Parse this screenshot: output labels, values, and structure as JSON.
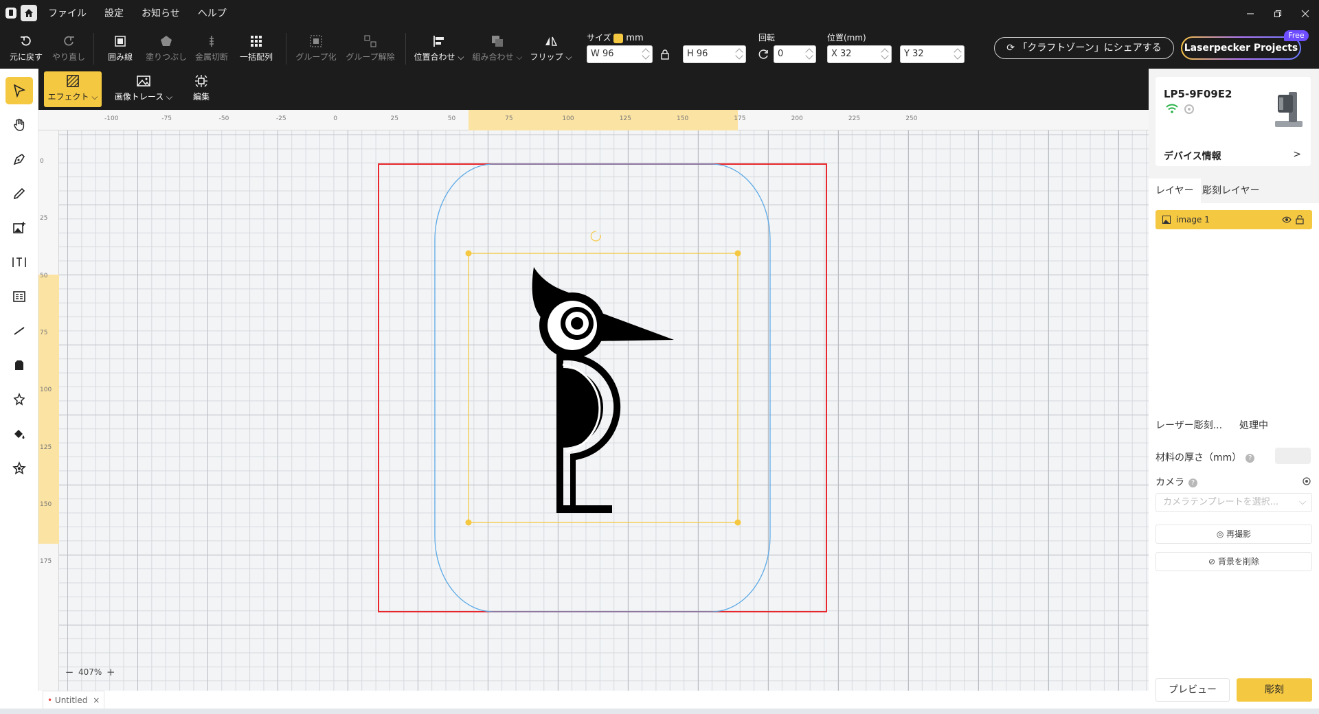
{
  "menu": [
    "ファイル",
    "設定",
    "お知らせ",
    "ヘルプ"
  ],
  "toolbar": {
    "undo": "元に戻す",
    "redo": "やり直し",
    "outline": "囲み線",
    "fill": "塗りつぶし",
    "metal_cut": "金属切断",
    "array": "一括配列",
    "group": "グループ化",
    "ungroup": "グループ解除",
    "align": "位置合わせ",
    "combine": "組み合わせ",
    "flip": "フリップ",
    "size_label": "サイズ",
    "unit": "mm",
    "width": "W 96",
    "height": "H 96",
    "rotate_label": "回転",
    "rotate": "0",
    "position_label": "位置(mm)",
    "x": "X 32",
    "y": "Y 32",
    "share": "「クラフトゾーン」にシェアする",
    "projects": "Laserpecker Projects",
    "free": "Free"
  },
  "subbar": {
    "effect": "エフェクト",
    "trace": "画像トレース",
    "edit": "編集"
  },
  "ruler": {
    "top": [
      "-100",
      "-75",
      "-50",
      "-25",
      "0",
      "25",
      "50",
      "75",
      "100",
      "125",
      "150",
      "175",
      "200",
      "225",
      "250"
    ],
    "left": [
      "0",
      "25",
      "50",
      "75",
      "100",
      "125",
      "150",
      "175"
    ]
  },
  "zoom": "407%",
  "doc_tab": "Untitled",
  "device": {
    "name": "LP5-9F09E2",
    "info": "デバイス情報"
  },
  "layers": {
    "tab_layer": "レイヤー",
    "tab_engrave": "彫刻レイヤー",
    "items": [
      "image 1"
    ]
  },
  "process": {
    "tab_laser": "レーザー彫刻...",
    "tab_processing": "処理中",
    "thickness_label": "材料の厚さ（mm）",
    "camera_label": "カメラ",
    "camera_placeholder": "カメラテンプレートを選択...",
    "retake": "再撮影",
    "remove_bg": "背景を削除",
    "preview": "プレビュー",
    "engrave": "彫刻"
  },
  "colors": {
    "accent": "#f5c842",
    "workspace_border": "#e8262b",
    "device_outline": "#5aa9e6"
  }
}
